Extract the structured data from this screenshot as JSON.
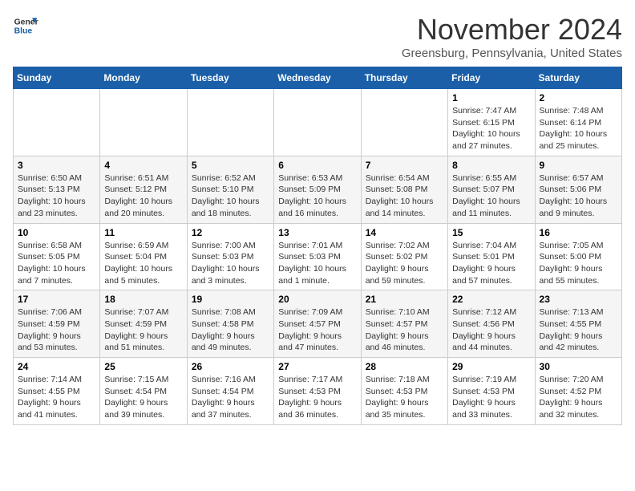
{
  "header": {
    "logo_line1": "General",
    "logo_line2": "Blue",
    "month_title": "November 2024",
    "location": "Greensburg, Pennsylvania, United States"
  },
  "days_of_week": [
    "Sunday",
    "Monday",
    "Tuesday",
    "Wednesday",
    "Thursday",
    "Friday",
    "Saturday"
  ],
  "weeks": [
    [
      {
        "day": "",
        "info": ""
      },
      {
        "day": "",
        "info": ""
      },
      {
        "day": "",
        "info": ""
      },
      {
        "day": "",
        "info": ""
      },
      {
        "day": "",
        "info": ""
      },
      {
        "day": "1",
        "info": "Sunrise: 7:47 AM\nSunset: 6:15 PM\nDaylight: 10 hours and 27 minutes."
      },
      {
        "day": "2",
        "info": "Sunrise: 7:48 AM\nSunset: 6:14 PM\nDaylight: 10 hours and 25 minutes."
      }
    ],
    [
      {
        "day": "3",
        "info": "Sunrise: 6:50 AM\nSunset: 5:13 PM\nDaylight: 10 hours and 23 minutes."
      },
      {
        "day": "4",
        "info": "Sunrise: 6:51 AM\nSunset: 5:12 PM\nDaylight: 10 hours and 20 minutes."
      },
      {
        "day": "5",
        "info": "Sunrise: 6:52 AM\nSunset: 5:10 PM\nDaylight: 10 hours and 18 minutes."
      },
      {
        "day": "6",
        "info": "Sunrise: 6:53 AM\nSunset: 5:09 PM\nDaylight: 10 hours and 16 minutes."
      },
      {
        "day": "7",
        "info": "Sunrise: 6:54 AM\nSunset: 5:08 PM\nDaylight: 10 hours and 14 minutes."
      },
      {
        "day": "8",
        "info": "Sunrise: 6:55 AM\nSunset: 5:07 PM\nDaylight: 10 hours and 11 minutes."
      },
      {
        "day": "9",
        "info": "Sunrise: 6:57 AM\nSunset: 5:06 PM\nDaylight: 10 hours and 9 minutes."
      }
    ],
    [
      {
        "day": "10",
        "info": "Sunrise: 6:58 AM\nSunset: 5:05 PM\nDaylight: 10 hours and 7 minutes."
      },
      {
        "day": "11",
        "info": "Sunrise: 6:59 AM\nSunset: 5:04 PM\nDaylight: 10 hours and 5 minutes."
      },
      {
        "day": "12",
        "info": "Sunrise: 7:00 AM\nSunset: 5:03 PM\nDaylight: 10 hours and 3 minutes."
      },
      {
        "day": "13",
        "info": "Sunrise: 7:01 AM\nSunset: 5:03 PM\nDaylight: 10 hours and 1 minute."
      },
      {
        "day": "14",
        "info": "Sunrise: 7:02 AM\nSunset: 5:02 PM\nDaylight: 9 hours and 59 minutes."
      },
      {
        "day": "15",
        "info": "Sunrise: 7:04 AM\nSunset: 5:01 PM\nDaylight: 9 hours and 57 minutes."
      },
      {
        "day": "16",
        "info": "Sunrise: 7:05 AM\nSunset: 5:00 PM\nDaylight: 9 hours and 55 minutes."
      }
    ],
    [
      {
        "day": "17",
        "info": "Sunrise: 7:06 AM\nSunset: 4:59 PM\nDaylight: 9 hours and 53 minutes."
      },
      {
        "day": "18",
        "info": "Sunrise: 7:07 AM\nSunset: 4:59 PM\nDaylight: 9 hours and 51 minutes."
      },
      {
        "day": "19",
        "info": "Sunrise: 7:08 AM\nSunset: 4:58 PM\nDaylight: 9 hours and 49 minutes."
      },
      {
        "day": "20",
        "info": "Sunrise: 7:09 AM\nSunset: 4:57 PM\nDaylight: 9 hours and 47 minutes."
      },
      {
        "day": "21",
        "info": "Sunrise: 7:10 AM\nSunset: 4:57 PM\nDaylight: 9 hours and 46 minutes."
      },
      {
        "day": "22",
        "info": "Sunrise: 7:12 AM\nSunset: 4:56 PM\nDaylight: 9 hours and 44 minutes."
      },
      {
        "day": "23",
        "info": "Sunrise: 7:13 AM\nSunset: 4:55 PM\nDaylight: 9 hours and 42 minutes."
      }
    ],
    [
      {
        "day": "24",
        "info": "Sunrise: 7:14 AM\nSunset: 4:55 PM\nDaylight: 9 hours and 41 minutes."
      },
      {
        "day": "25",
        "info": "Sunrise: 7:15 AM\nSunset: 4:54 PM\nDaylight: 9 hours and 39 minutes."
      },
      {
        "day": "26",
        "info": "Sunrise: 7:16 AM\nSunset: 4:54 PM\nDaylight: 9 hours and 37 minutes."
      },
      {
        "day": "27",
        "info": "Sunrise: 7:17 AM\nSunset: 4:53 PM\nDaylight: 9 hours and 36 minutes."
      },
      {
        "day": "28",
        "info": "Sunrise: 7:18 AM\nSunset: 4:53 PM\nDaylight: 9 hours and 35 minutes."
      },
      {
        "day": "29",
        "info": "Sunrise: 7:19 AM\nSunset: 4:53 PM\nDaylight: 9 hours and 33 minutes."
      },
      {
        "day": "30",
        "info": "Sunrise: 7:20 AM\nSunset: 4:52 PM\nDaylight: 9 hours and 32 minutes."
      }
    ]
  ]
}
